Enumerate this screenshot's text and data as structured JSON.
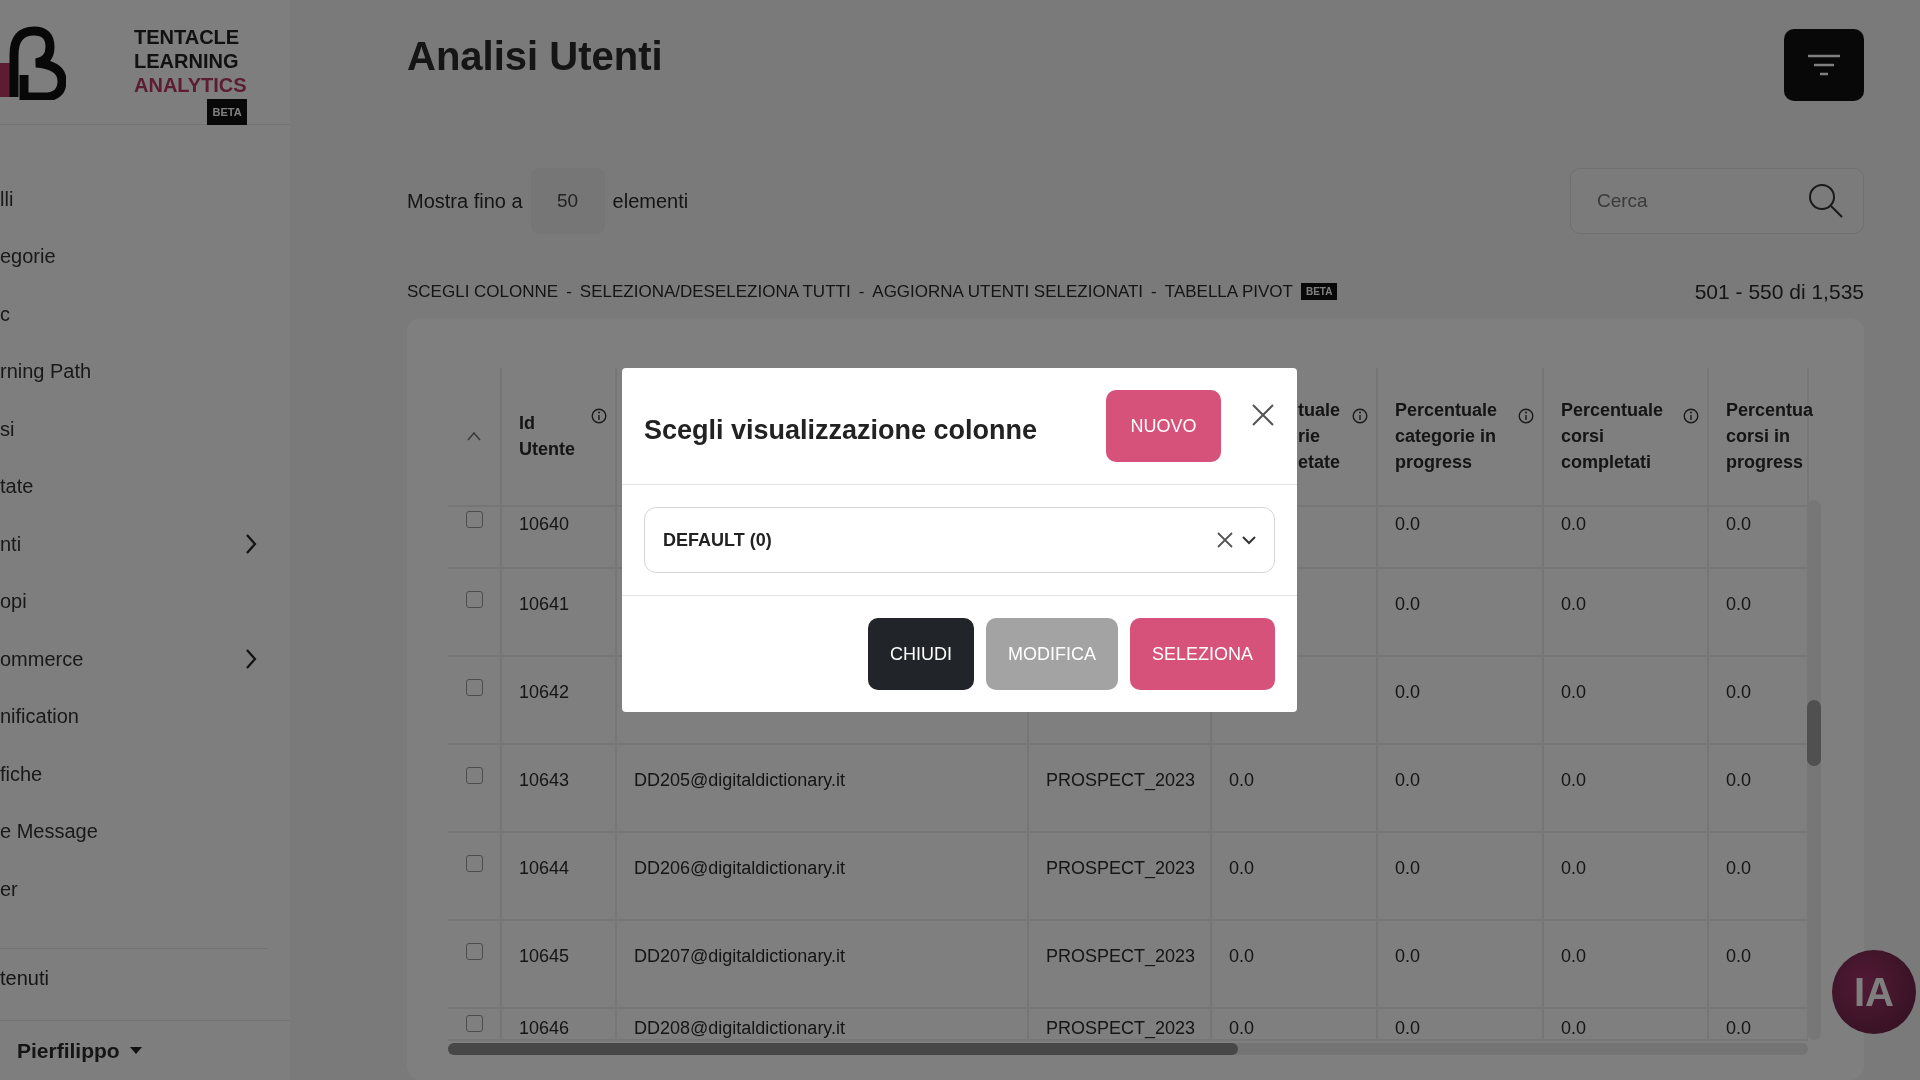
{
  "sidebar": {
    "brand": [
      "TENTACLE",
      "LEARNING",
      "ANALYTICS"
    ],
    "brand_badge": "BETA",
    "items": [
      {
        "label": "lli",
        "submenu": false
      },
      {
        "label": "egorie",
        "submenu": false
      },
      {
        "label": "c",
        "submenu": false
      },
      {
        "label": "rning Path",
        "submenu": false
      },
      {
        "label": "si",
        "submenu": false
      },
      {
        "label": "tate",
        "submenu": false
      },
      {
        "label": "nti",
        "submenu": true
      },
      {
        "label": "opi",
        "submenu": false
      },
      {
        "label": "ommerce",
        "submenu": true
      },
      {
        "label": "nification",
        "submenu": false
      },
      {
        "label": "fiche",
        "submenu": false
      },
      {
        "label": "e Message",
        "submenu": false
      },
      {
        "label": "er",
        "submenu": false
      }
    ],
    "footer_item": "tenuti",
    "user": "Pierfilippo"
  },
  "page": {
    "title": "Analisi Utenti"
  },
  "page_size": {
    "prefix": "Mostra fino a",
    "value": "50",
    "suffix": "elementi"
  },
  "search": {
    "placeholder": "Cerca"
  },
  "actions": {
    "links": [
      "SCEGLI COLONNE",
      "SELEZIONA/DESELEZIONA TUTTI",
      "AGGIORNA UTENTI SELEZIONATI",
      "TABELLA PIVOT"
    ],
    "separator": "-",
    "badge": "BETA"
  },
  "range": "501 - 550 di 1,535",
  "table": {
    "columns": [
      {
        "label": "Id Utente",
        "info": true
      },
      {},
      {},
      {
        "label": "tuale rie etate",
        "info": true
      },
      {
        "label": "Percentuale categorie in progress",
        "info": true
      },
      {
        "label": "Percentuale corsi completati",
        "info": true
      },
      {
        "label": "Percentua corsi in progress",
        "info": false
      }
    ],
    "rows": [
      {
        "checked": false,
        "cells": [
          "10640",
          null,
          null,
          null,
          "0.0",
          "0.0",
          "0.0"
        ]
      },
      {
        "checked": false,
        "cells": [
          "10641",
          null,
          null,
          null,
          "0.0",
          "0.0",
          "0.0"
        ]
      },
      {
        "checked": false,
        "cells": [
          "10642",
          null,
          null,
          null,
          "0.0",
          "0.0",
          "0.0"
        ]
      },
      {
        "checked": false,
        "cells": [
          "10643",
          "DD205@digitaldictionary.it",
          "PROSPECT_2023",
          "0.0",
          "0.0",
          "0.0",
          "0.0"
        ]
      },
      {
        "checked": false,
        "cells": [
          "10644",
          "DD206@digitaldictionary.it",
          "PROSPECT_2023",
          "0.0",
          "0.0",
          "0.0",
          "0.0"
        ]
      },
      {
        "checked": false,
        "cells": [
          "10645",
          "DD207@digitaldictionary.it",
          "PROSPECT_2023",
          "0.0",
          "0.0",
          "0.0",
          "0.0"
        ]
      },
      {
        "checked": false,
        "cells": [
          "10646",
          "DD208@digitaldictionary.it",
          "PROSPECT_2023",
          "0.0",
          "0.0",
          "0.0",
          "0.0"
        ]
      }
    ]
  },
  "modal": {
    "title": "Scegli visualizzazione colonne",
    "new_button": "NUOVO",
    "select_value": "DEFAULT (0)",
    "buttons": [
      {
        "label": "CHIUDI",
        "kind": "dark",
        "disabled": false
      },
      {
        "label": "MODIFICA",
        "kind": "light",
        "disabled": true
      },
      {
        "label": "SELEZIONA",
        "kind": "primary",
        "disabled": false
      }
    ]
  },
  "assistant": {
    "label": "IA"
  }
}
